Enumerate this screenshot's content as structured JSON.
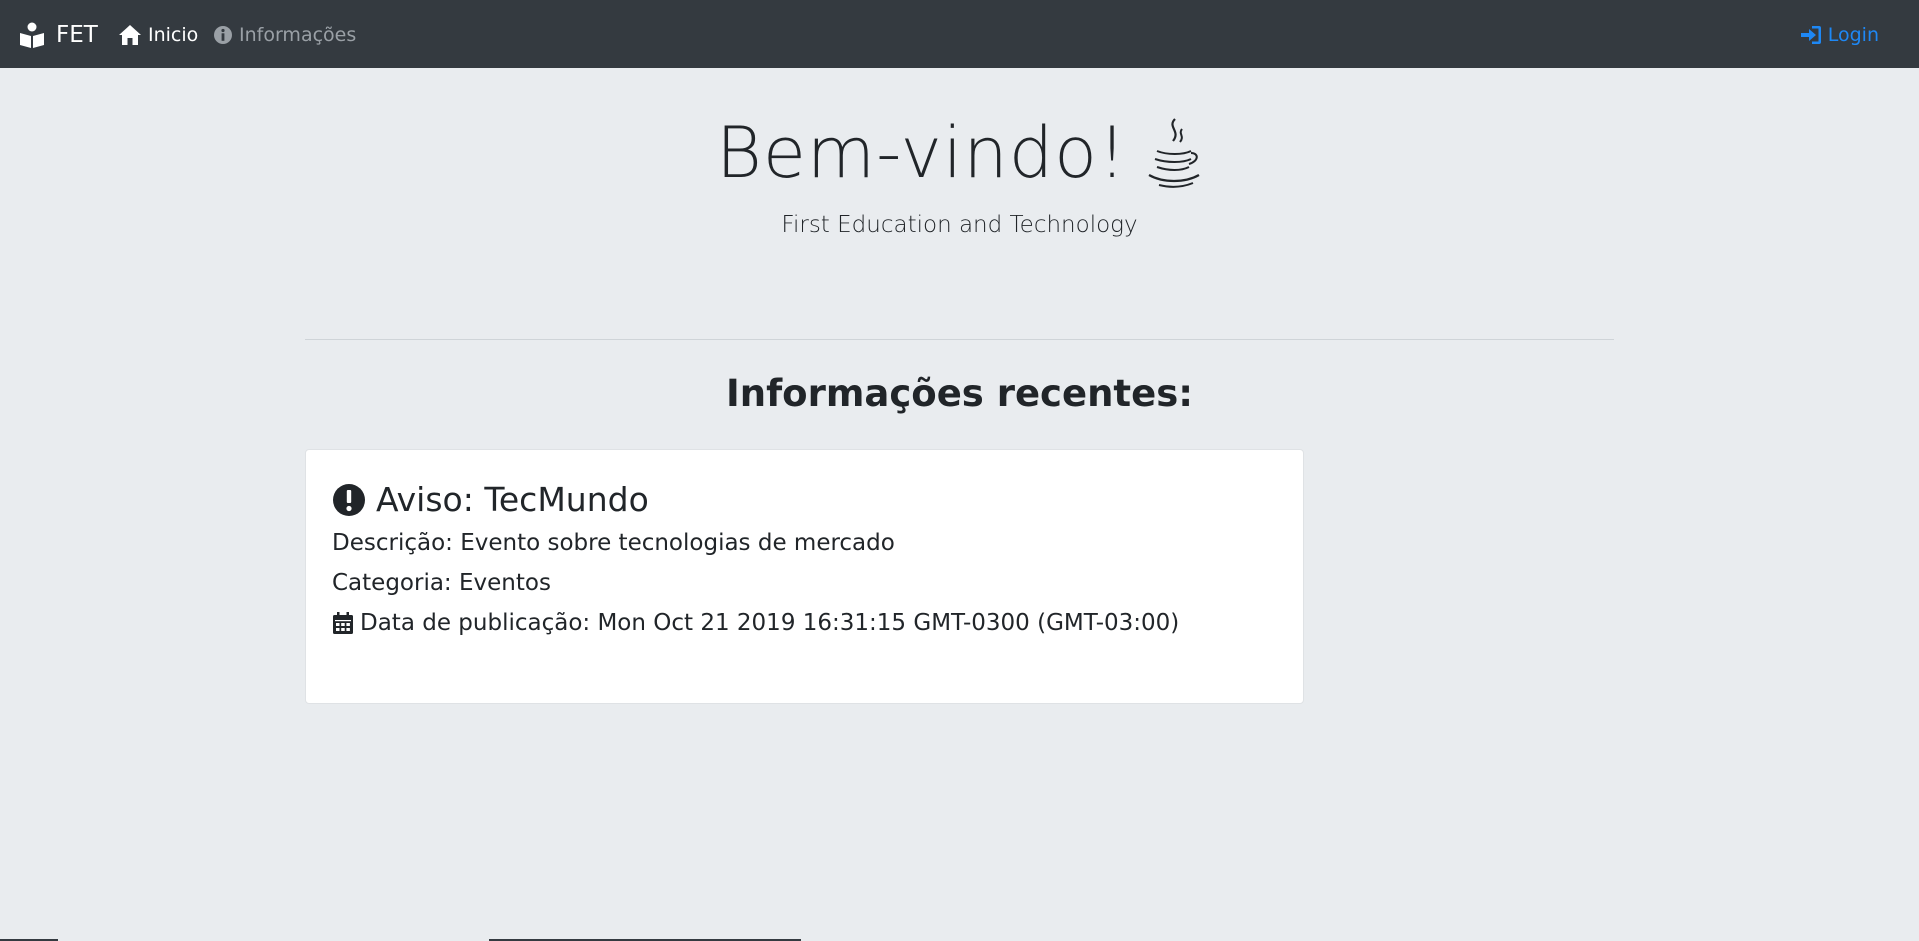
{
  "navbar": {
    "brand": "FET",
    "brand_icon": "book-reader-icon",
    "links": [
      {
        "label": "Inicio",
        "icon": "home-icon"
      },
      {
        "label": "Informações",
        "icon": "info-circle-icon"
      }
    ],
    "login": {
      "label": "Login",
      "icon": "sign-in-icon"
    }
  },
  "hero": {
    "title": "Bem-vindo!",
    "title_icon": "java-coffee-icon",
    "subtitle": "First Education and Technology"
  },
  "section": {
    "title": "Informações recentes:"
  },
  "card": {
    "title": "Aviso: TecMundo",
    "title_icon": "exclamation-circle-icon",
    "description": "Descrição: Evento sobre tecnologias de mercado",
    "category": "Categoria: Eventos",
    "date": "Data de publicação: Mon Oct 21 2019 16:31:15 GMT-0300 (GMT-03:00)",
    "date_icon": "calendar-icon"
  },
  "colors": {
    "navbar_bg": "#343a40",
    "page_bg": "#e9ecef",
    "link_active": "#ffffff",
    "link_muted": "#9aa0a6",
    "login": "#1e88f5"
  }
}
